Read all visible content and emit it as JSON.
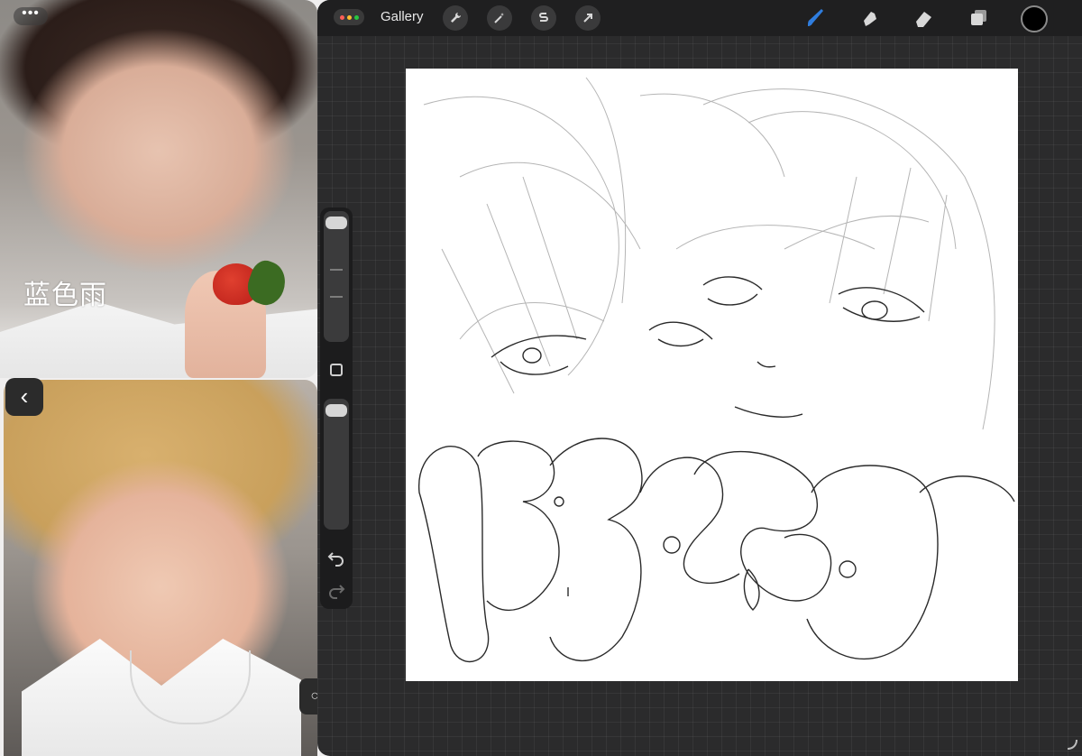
{
  "slideover": {
    "watermark": "蓝色雨",
    "more_label": "•••",
    "back_label": "‹",
    "edge_label": "○"
  },
  "toolbar": {
    "gallery_label": "Gallery",
    "left_tools": [
      "wrench-icon",
      "magic-wand-icon",
      "selection-s-icon",
      "transform-arrow-icon"
    ],
    "right_tools": [
      "brush-icon",
      "smudge-icon",
      "eraser-icon",
      "layers-icon"
    ],
    "active_tool": "brush-icon",
    "current_color": "#000000",
    "active_color": "#2f7dde"
  },
  "sidebar": {
    "undo_label": "↶",
    "redo_label": "↷"
  },
  "canvas": {
    "sketch_text": "HBSOR"
  }
}
